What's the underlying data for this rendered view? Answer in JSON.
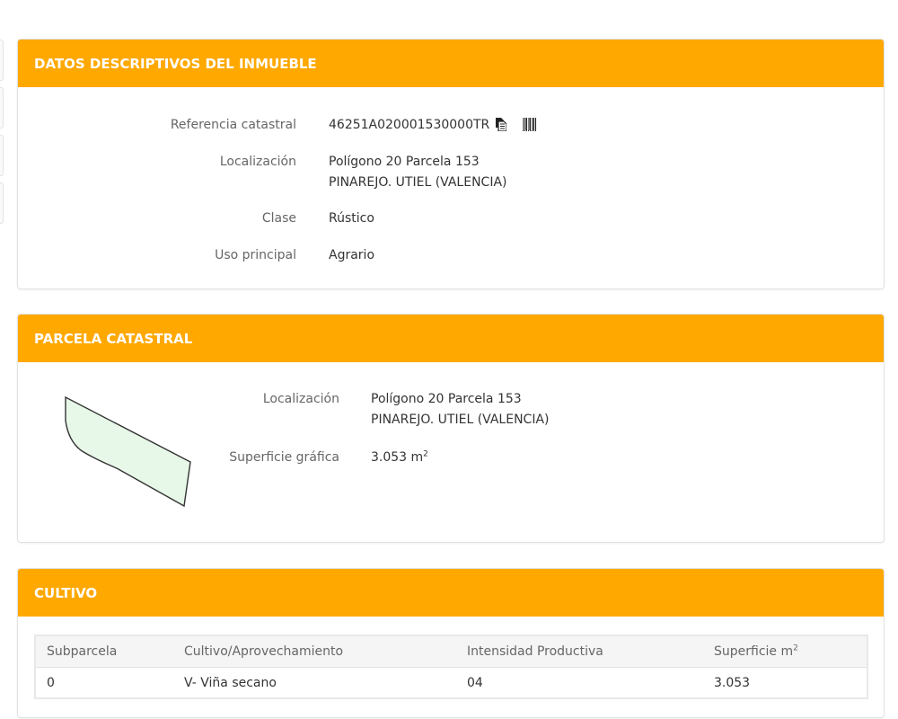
{
  "datos": {
    "header": "DATOS DESCRIPTIVOS DEL INMUEBLE",
    "ref_label": "Referencia catastral",
    "ref_value": "46251A020001530000TR",
    "copy_icon": "copy-icon",
    "barcode_icon": "barcode-icon",
    "loc_label": "Localización",
    "loc_line1": "Polígono 20 Parcela 153",
    "loc_line2": "PINAREJO. UTIEL (VALENCIA)",
    "clase_label": "Clase",
    "clase_value": "Rústico",
    "uso_label": "Uso principal",
    "uso_value": "Agrario"
  },
  "parcela": {
    "header": "PARCELA CATASTRAL",
    "loc_label": "Localización",
    "loc_line1": "Polígono 20 Parcela 153",
    "loc_line2": "PINAREJO. UTIEL (VALENCIA)",
    "sup_label": "Superficie gráfica",
    "sup_value": "3.053 m",
    "sup_exp": "2"
  },
  "cultivo": {
    "header": "CULTIVO",
    "columns": {
      "subparcela": "Subparcela",
      "cultivo": "Cultivo/Aprovechamiento",
      "intensidad": "Intensidad Productiva",
      "superficie": "Superficie m",
      "superficie_exp": "2"
    },
    "rows": [
      {
        "subparcela": "0",
        "cultivo": "V- Viña secano",
        "intensidad": "04",
        "superficie": "3.053"
      }
    ]
  },
  "colors": {
    "header_bg": "#ffa800",
    "parcel_fill": "#e8f8e8",
    "parcel_stroke": "#333333"
  }
}
